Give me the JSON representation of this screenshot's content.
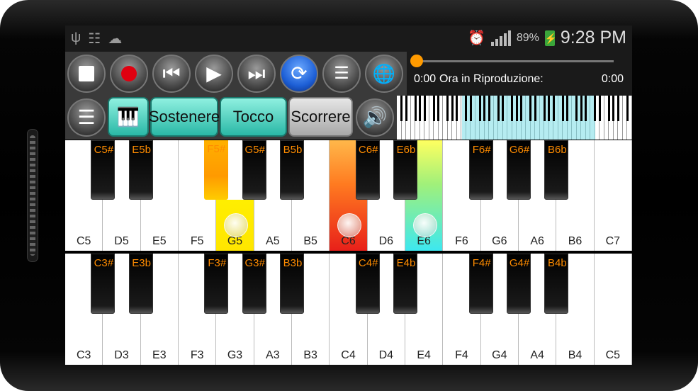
{
  "statusbar": {
    "icons_left": [
      "usb-icon",
      "radio-icon",
      "cloud-icon"
    ],
    "alarm_icon": "alarm-icon",
    "battery_pct": "89%",
    "battery_level": 0.89,
    "time": "9:28 PM"
  },
  "toolbar": {
    "buttons": [
      "stop",
      "record",
      "previous",
      "play",
      "next",
      "loop",
      "playlist",
      "globe"
    ],
    "player": {
      "current_time": "0:00",
      "label": "Ora in Riproduzione:",
      "total_time": "0:00",
      "progress": 0
    }
  },
  "toolbar2": {
    "menu_icon": "menu-icon",
    "piano_icon": "piano-icon",
    "sustain_label": "Sostenere",
    "touch_label": "Tocco",
    "scroll_label": "Scorrere",
    "volume_icon": "volume-icon"
  },
  "upper_keyboard": {
    "white_keys": [
      "C5",
      "D5",
      "E5",
      "F5",
      "G5",
      "A5",
      "B5",
      "C6",
      "D6",
      "E6",
      "F6",
      "G6",
      "A6",
      "B6",
      "C7"
    ],
    "black_keys": [
      "C5#",
      "E5b",
      "F5#",
      "G5#",
      "B5b",
      "C6#",
      "E6b",
      "F6#",
      "G6#",
      "B6b"
    ],
    "pressed": [
      "G5",
      "F5#",
      "C6",
      "E6"
    ]
  },
  "lower_keyboard": {
    "white_keys": [
      "C3",
      "D3",
      "E3",
      "F3",
      "G3",
      "A3",
      "B3",
      "C4",
      "D4",
      "E4",
      "F4",
      "G4",
      "A4",
      "B4",
      "C5"
    ],
    "black_keys": [
      "C3#",
      "E3b",
      "F3#",
      "G3#",
      "B3b",
      "C4#",
      "E4b",
      "F4#",
      "G4#",
      "B4b"
    ]
  },
  "colors": {
    "teal_button": "#2ab8a6",
    "accent_orange": "#ff8c00",
    "loop_blue": "#1d5fd6",
    "key_g5": "#ffe600",
    "key_f5s": "#ff9a00",
    "key_c6": "#e8201a",
    "key_e6": "#3de8f0"
  }
}
